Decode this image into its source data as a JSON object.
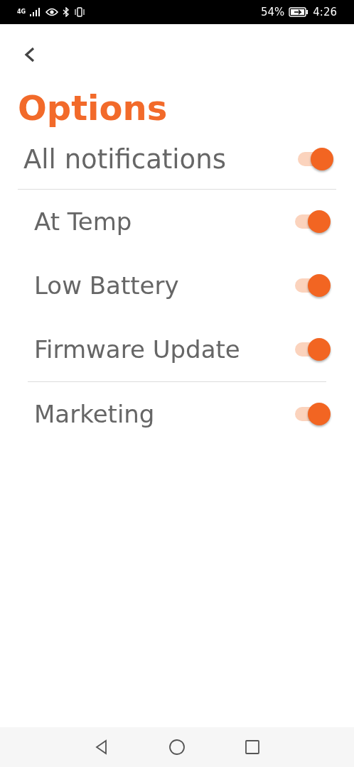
{
  "status_bar": {
    "network": "4G",
    "battery": "54%",
    "time": "4:26"
  },
  "title": "Options",
  "groups": [
    {
      "items": [
        {
          "kind": "main",
          "label": "All notifications",
          "on": true
        }
      ]
    },
    {
      "items": [
        {
          "kind": "sub",
          "label": "At Temp",
          "on": true
        },
        {
          "kind": "sub",
          "label": "Low Battery",
          "on": true
        },
        {
          "kind": "sub",
          "label": "Firmware Update",
          "on": true
        }
      ]
    },
    {
      "items": [
        {
          "kind": "sub",
          "label": "Marketing",
          "on": true
        }
      ]
    }
  ]
}
